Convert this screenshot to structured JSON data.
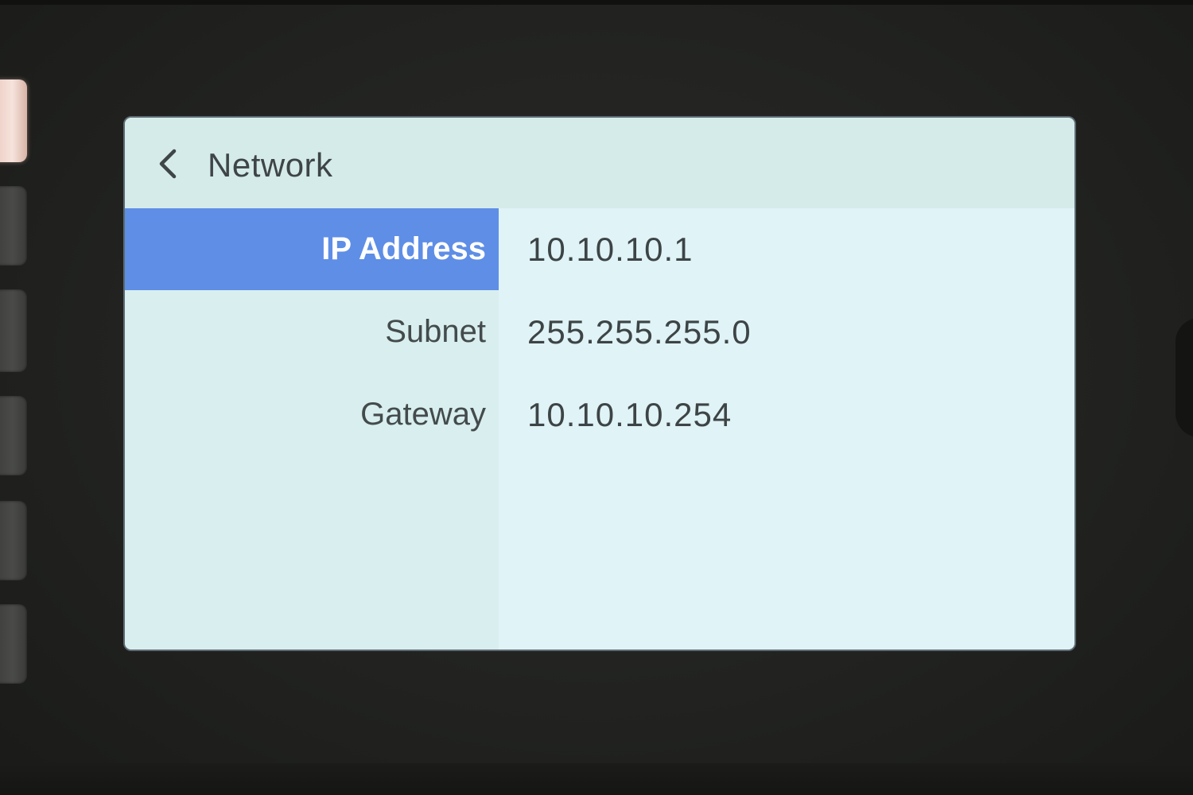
{
  "header": {
    "title": "Network",
    "back_icon": "chevron-left-icon"
  },
  "settings": [
    {
      "label": "IP Address",
      "value": "10.10.10.1",
      "selected": true
    },
    {
      "label": "Subnet",
      "value": "255.255.255.0",
      "selected": false
    },
    {
      "label": "Gateway",
      "value": "10.10.10.254",
      "selected": false
    }
  ],
  "colors": {
    "selection": "#5e8ee6",
    "screen_background": "#dff0f2",
    "text": "#3e4547"
  }
}
